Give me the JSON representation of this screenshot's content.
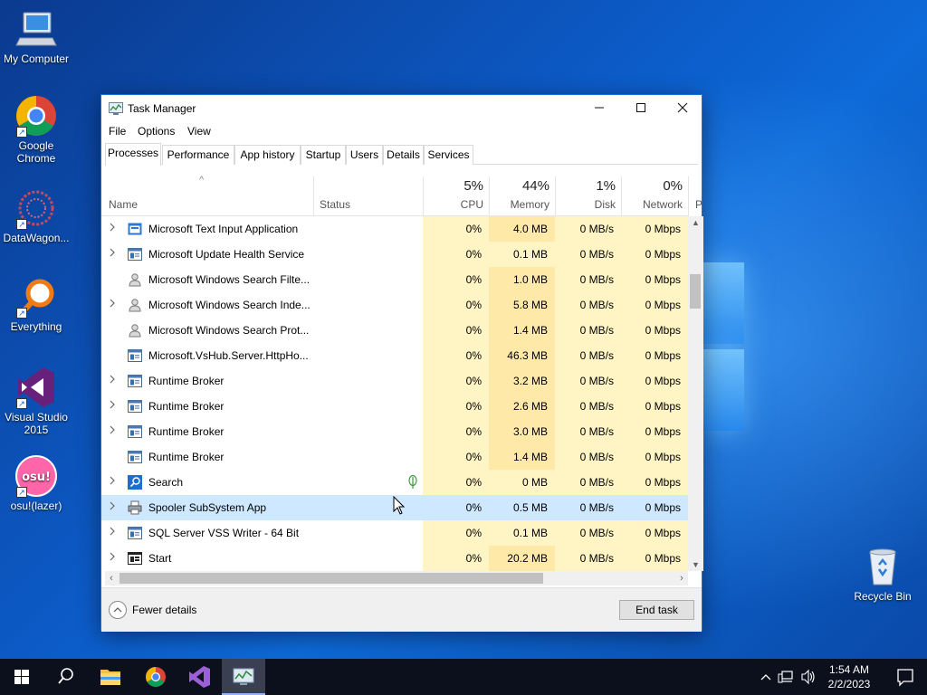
{
  "desktop": {
    "icons": [
      {
        "label": "My Computer",
        "icon": "computer-icon"
      },
      {
        "label": "Google Chrome",
        "icon": "chrome-icon"
      },
      {
        "label": "DataWagon...",
        "icon": "datawagon-icon"
      },
      {
        "label": "Everything",
        "icon": "everything-search-icon"
      },
      {
        "label": "Visual Studio 2015",
        "icon": "visual-studio-icon"
      },
      {
        "label": "osu!(lazer)",
        "icon": "osu-icon"
      },
      {
        "label": "Recycle Bin",
        "icon": "recycle-bin-icon"
      }
    ]
  },
  "window": {
    "title": "Task Manager",
    "controls": {
      "minimize": "—",
      "maximize": "☐",
      "close": "✕"
    }
  },
  "menu": [
    "File",
    "Options",
    "View"
  ],
  "tabs": [
    "Processes",
    "Performance",
    "App history",
    "Startup",
    "Users",
    "Details",
    "Services"
  ],
  "active_tab": "Processes",
  "columns": {
    "name": "Name",
    "status": "Status",
    "cpu": {
      "pct": "5%",
      "label": "CPU"
    },
    "memory": {
      "pct": "44%",
      "label": "Memory"
    },
    "disk": {
      "pct": "1%",
      "label": "Disk"
    },
    "network": {
      "pct": "0%",
      "label": "Network"
    },
    "power_partial": "P",
    "sort_indicator": "^"
  },
  "processes": [
    {
      "name": "Microsoft Text Input Application",
      "expand": true,
      "icon": "app-window-icon",
      "cpu": "0%",
      "memory": "4.0 MB",
      "disk": "0 MB/s",
      "network": "0 Mbps"
    },
    {
      "name": "Microsoft Update Health Service",
      "expand": true,
      "icon": "service-icon",
      "cpu": "0%",
      "memory": "0.1 MB",
      "disk": "0 MB/s",
      "network": "0 Mbps"
    },
    {
      "name": "Microsoft Windows Search Filte...",
      "expand": false,
      "icon": "search-user-icon",
      "cpu": "0%",
      "memory": "1.0 MB",
      "disk": "0 MB/s",
      "network": "0 Mbps"
    },
    {
      "name": "Microsoft Windows Search Inde...",
      "expand": true,
      "icon": "search-user-icon",
      "cpu": "0%",
      "memory": "5.8 MB",
      "disk": "0 MB/s",
      "network": "0 Mbps"
    },
    {
      "name": "Microsoft Windows Search Prot...",
      "expand": false,
      "icon": "search-user-icon",
      "cpu": "0%",
      "memory": "1.4 MB",
      "disk": "0 MB/s",
      "network": "0 Mbps"
    },
    {
      "name": "Microsoft.VsHub.Server.HttpHo...",
      "expand": false,
      "icon": "service-icon",
      "cpu": "0%",
      "memory": "46.3 MB",
      "disk": "0 MB/s",
      "network": "0 Mbps"
    },
    {
      "name": "Runtime Broker",
      "expand": true,
      "icon": "service-icon",
      "cpu": "0%",
      "memory": "3.2 MB",
      "disk": "0 MB/s",
      "network": "0 Mbps"
    },
    {
      "name": "Runtime Broker",
      "expand": true,
      "icon": "service-icon",
      "cpu": "0%",
      "memory": "2.6 MB",
      "disk": "0 MB/s",
      "network": "0 Mbps"
    },
    {
      "name": "Runtime Broker",
      "expand": true,
      "icon": "service-icon",
      "cpu": "0%",
      "memory": "3.0 MB",
      "disk": "0 MB/s",
      "network": "0 Mbps"
    },
    {
      "name": "Runtime Broker",
      "expand": false,
      "icon": "service-icon",
      "cpu": "0%",
      "memory": "1.4 MB",
      "disk": "0 MB/s",
      "network": "0 Mbps"
    },
    {
      "name": "Search",
      "expand": true,
      "icon": "search-icon",
      "cpu": "0%",
      "memory": "0 MB",
      "disk": "0 MB/s",
      "network": "0 Mbps",
      "status_icon": "leaf-icon"
    },
    {
      "name": "Spooler SubSystem App",
      "expand": true,
      "icon": "printer-icon",
      "cpu": "0%",
      "memory": "0.5 MB",
      "disk": "0 MB/s",
      "network": "0 Mbps",
      "selected": true
    },
    {
      "name": "SQL Server VSS Writer - 64 Bit",
      "expand": true,
      "icon": "service-icon",
      "cpu": "0%",
      "memory": "0.1 MB",
      "disk": "0 MB/s",
      "network": "0 Mbps"
    },
    {
      "name": "Start",
      "expand": true,
      "icon": "start-icon",
      "cpu": "0%",
      "memory": "20.2 MB",
      "disk": "0 MB/s",
      "network": "0 Mbps"
    }
  ],
  "footer": {
    "fewer_details": "Fewer details",
    "end_task": "End task"
  },
  "taskbar": {
    "pinned": [
      "start-icon",
      "search-icon",
      "file-explorer-icon",
      "chrome-icon",
      "visual-studio-icon",
      "task-manager-icon"
    ],
    "time": "1:54 AM",
    "date": "2/2/2023"
  },
  "colors": {
    "accent": "#1b6fd6",
    "selected_row": "#cde8ff",
    "heat_light": "#fff4c4",
    "heat_medium": "#ffe9a8"
  }
}
